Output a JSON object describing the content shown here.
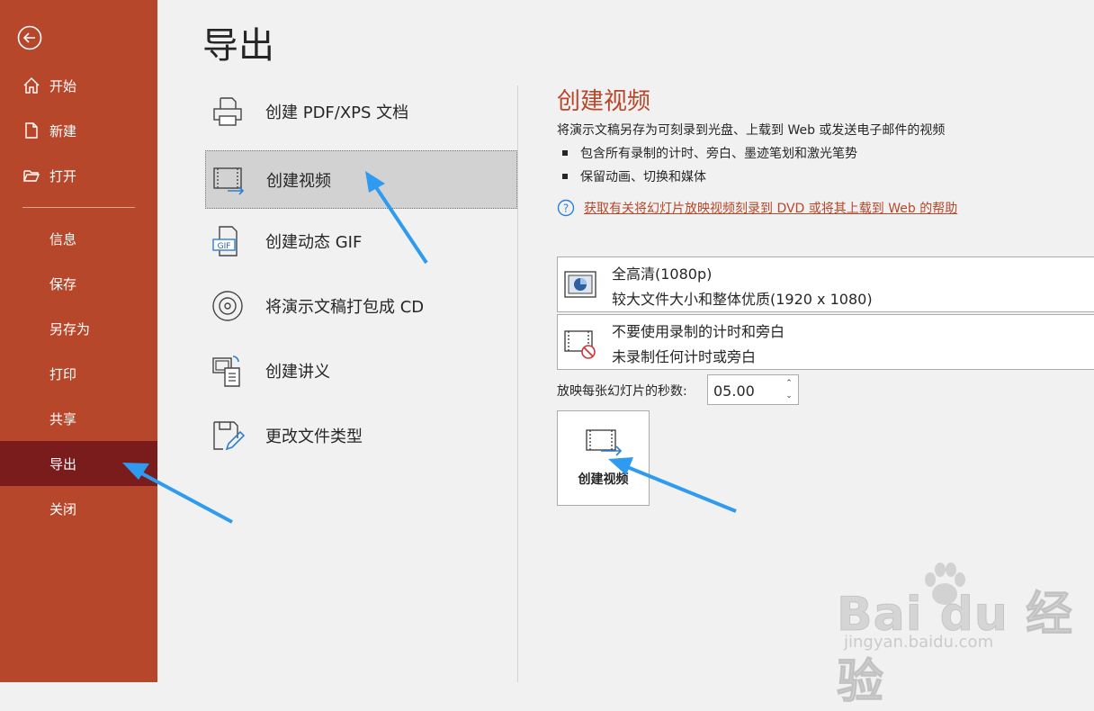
{
  "nav": {
    "items": [
      {
        "label": "开始",
        "icon": "home-icon"
      },
      {
        "label": "新建",
        "icon": "new-file-icon"
      },
      {
        "label": "打开",
        "icon": "folder-open-icon"
      },
      {
        "label": "信息"
      },
      {
        "label": "保存"
      },
      {
        "label": "另存为"
      },
      {
        "label": "打印"
      },
      {
        "label": "共享"
      },
      {
        "label": "导出",
        "active": true
      },
      {
        "label": "关闭"
      }
    ]
  },
  "page": {
    "title": "导出"
  },
  "export_options": [
    {
      "label": "创建 PDF/XPS 文档",
      "icon": "pdf-printer-icon"
    },
    {
      "label": "创建视频",
      "icon": "video-icon",
      "selected": true
    },
    {
      "label": "创建动态 GIF",
      "icon": "gif-icon"
    },
    {
      "label": "将演示文稿打包成 CD",
      "icon": "cd-icon"
    },
    {
      "label": "创建讲义",
      "icon": "handout-icon"
    },
    {
      "label": "更改文件类型",
      "icon": "change-file-type-icon"
    }
  ],
  "detail": {
    "title": "创建视频",
    "description": "将演示文稿另存为可刻录到光盘、上载到 Web 或发送电子邮件的视频",
    "bullets": [
      "包含所有录制的计时、旁白、墨迹笔划和激光笔势",
      "保留动画、切换和媒体"
    ],
    "help_link": "获取有关将幻灯片放映视频刻录到 DVD 或将其上载到 Web 的帮助",
    "quality": {
      "line1": "全高清(1080p)",
      "line2": "较大文件大小和整体优质(1920 x 1080)"
    },
    "timing": {
      "line1": "不要使用录制的计时和旁白",
      "line2": "未录制任何计时或旁白"
    },
    "seconds_label": "放映每张幻灯片的秒数:",
    "seconds_value": "05.00",
    "create_button": "创建视频"
  },
  "watermark": {
    "brand": "Bai du 经验",
    "url": "jingyan.baidu.com"
  },
  "colors": {
    "accent": "#b7472a",
    "active_nav": "#7b1c1c",
    "arrow": "#2e9bf0"
  }
}
